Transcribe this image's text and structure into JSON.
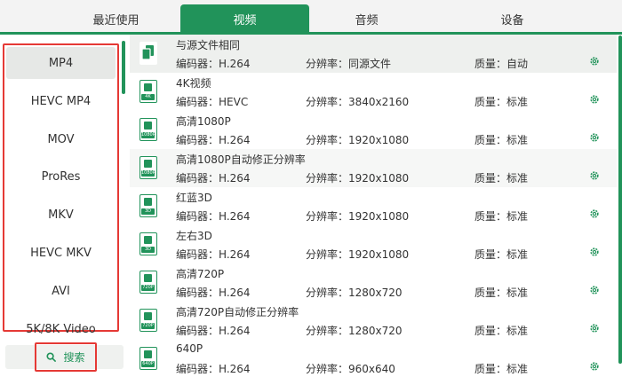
{
  "tabs": [
    {
      "label": "最近使用",
      "active": false
    },
    {
      "label": "视频",
      "active": true
    },
    {
      "label": "音频",
      "active": false
    },
    {
      "label": "设备",
      "active": false
    }
  ],
  "categories": [
    "MP4",
    "HEVC MP4",
    "MOV",
    "ProRes",
    "MKV",
    "HEVC MKV",
    "AVI",
    "5K/8K Video"
  ],
  "selected_category": "MP4",
  "search": {
    "label": "搜索",
    "icon": "search-icon"
  },
  "accent_color": "#21935a",
  "highlight_color": "#e53935",
  "presets": [
    {
      "name": "与源文件相同",
      "icon_label": "",
      "encoder": "编码器：H.264",
      "resolution": "分辨率：同源文件",
      "quality": "质量：自动"
    },
    {
      "name": "4K视频",
      "icon_label": "4K",
      "encoder": "编码器：HEVC",
      "resolution": "分辨率：3840x2160",
      "quality": "质量：标准"
    },
    {
      "name": "高清1080P",
      "icon_label": "1080P",
      "encoder": "编码器：H.264",
      "resolution": "分辨率：1920x1080",
      "quality": "质量：标准"
    },
    {
      "name": "高清1080P自动修正分辨率",
      "icon_label": "1080P",
      "encoder": "编码器：H.264",
      "resolution": "分辨率：1920x1080",
      "quality": "质量：标准"
    },
    {
      "name": "红蓝3D",
      "icon_label": "3D",
      "encoder": "编码器：H.264",
      "resolution": "分辨率：1920x1080",
      "quality": "质量：标准"
    },
    {
      "name": "左右3D",
      "icon_label": "3D",
      "encoder": "编码器：H.264",
      "resolution": "分辨率：1920x1080",
      "quality": "质量：标准"
    },
    {
      "name": "高清720P",
      "icon_label": "720P",
      "encoder": "编码器：H.264",
      "resolution": "分辨率：1280x720",
      "quality": "质量：标准"
    },
    {
      "name": "高清720P自动修正分辨率",
      "icon_label": "720P",
      "encoder": "编码器：H.264",
      "resolution": "分辨率：1280x720",
      "quality": "质量：标准"
    },
    {
      "name": "640P",
      "icon_label": "640P",
      "encoder": "编码器：H.264",
      "resolution": "分辨率：960x640",
      "quality": "质量：标准"
    }
  ]
}
